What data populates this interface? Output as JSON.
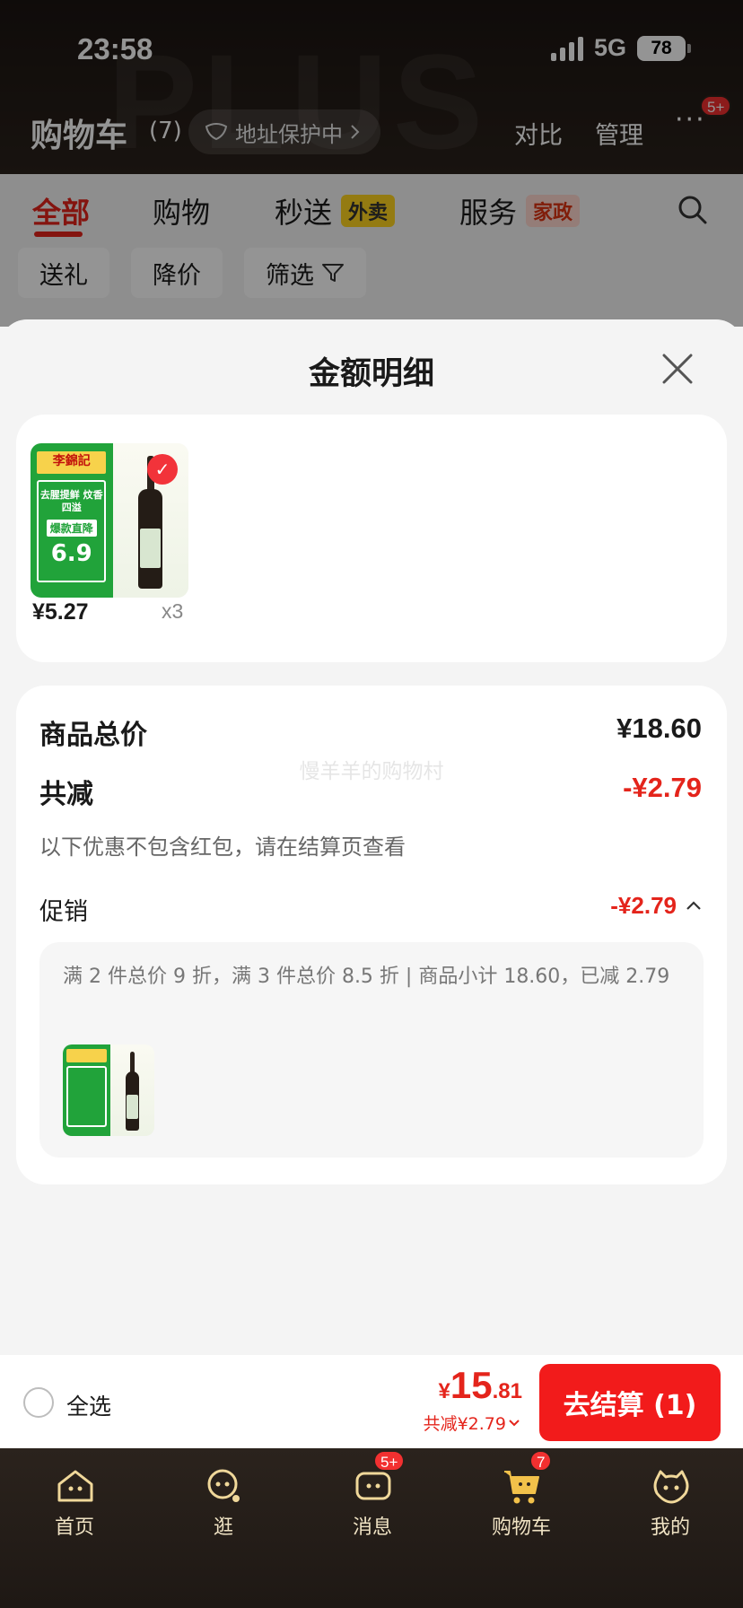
{
  "status_bar": {
    "time": "23:58",
    "network": "5G",
    "battery": "78"
  },
  "header": {
    "watermark": "PLUS",
    "title": "购物车",
    "count": "(7)",
    "address_pill": "地址保护中",
    "compare": "对比",
    "manage": "管理",
    "more_badge": "5+"
  },
  "tabs": {
    "items": [
      "全部",
      "购物",
      "秒送",
      "服务"
    ],
    "tags": [
      "外卖",
      "家政"
    ],
    "active": "全部"
  },
  "filters": [
    "送礼",
    "降价",
    "筛选"
  ],
  "sheet": {
    "title": "金额明细",
    "product": {
      "price": "¥5.27",
      "qty": "x3",
      "image_text": {
        "brand": "李錦記",
        "tagline": "去腥提鲜 炆香四溢",
        "promo": "爆款直降",
        "price": "6.9"
      }
    },
    "goods_total_label": "商品总价",
    "goods_total_value": "¥18.60",
    "discount_label": "共减",
    "discount_value": "-¥2.79",
    "watermark": "慢羊羊的购物村",
    "note": "以下优惠不包含红包，请在结算页查看",
    "promo_label": "促销",
    "promo_value": "-¥2.79",
    "promo_detail": "满 2 件总价 9 折，满 3 件总价 8.5 折 | 商品小计 18.60，已减 2.79"
  },
  "checkout": {
    "select_all": "全选",
    "currency": "¥",
    "total_int": "15",
    "total_dec": ".81",
    "discount_text": "共减¥2.79",
    "button": "去结算 (1)"
  },
  "tab_bar": {
    "items": [
      {
        "label": "首页",
        "icon": "home-icon"
      },
      {
        "label": "逛",
        "icon": "browse-icon"
      },
      {
        "label": "消息",
        "icon": "message-icon",
        "badge": "5+"
      },
      {
        "label": "购物车",
        "icon": "cart-icon",
        "badge": "7"
      },
      {
        "label": "我的",
        "icon": "profile-icon"
      }
    ]
  },
  "colors": {
    "accent_red": "#e4241b",
    "checkout_red": "#f21b1b",
    "tab_gold": "#f0e3c4"
  }
}
